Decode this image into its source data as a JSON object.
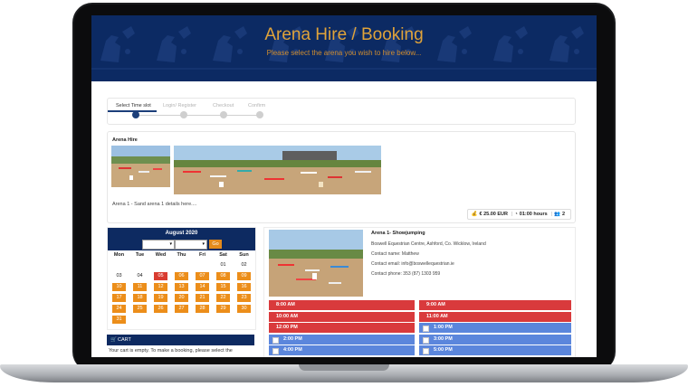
{
  "banner": {
    "title": "Arena Hire / Booking",
    "subtitle": "Please select the arena you wish to hire below..."
  },
  "steps": [
    "Select Time slot",
    "Login/ Register",
    "Checkout",
    "Confirm"
  ],
  "arena_card": {
    "title": "Arena Hire",
    "description": "Arena 1 - Sand arena 1 details here....",
    "price": "€ 25.00 EUR",
    "duration": "01:00 hours",
    "capacity": "2"
  },
  "calendar": {
    "month_label": "August   2020",
    "go_label": "Go",
    "weekdays": [
      "Mon",
      "Tue",
      "Wed",
      "Thu",
      "Fri",
      "Sat",
      "Sun"
    ],
    "days": [
      "01",
      "02",
      "03",
      "04",
      "05",
      "06",
      "07",
      "08",
      "09",
      "10",
      "11",
      "12",
      "13",
      "14",
      "15",
      "16",
      "17",
      "18",
      "19",
      "20",
      "21",
      "22",
      "23",
      "24",
      "25",
      "26",
      "27",
      "28",
      "29",
      "30",
      "31"
    ]
  },
  "cart": {
    "title": "CART",
    "message": "Your cart is empty. To make a booking, please select the"
  },
  "detail": {
    "name": "Arena 1- Showjumping",
    "address": "Boswell Equestrian Centre, Ashford, Co. Wicklow, Ireland",
    "contact_name": "Contact name: Matthew",
    "contact_email": "Contact email: info@boswellequestrian.ie",
    "contact_phone": "Contact phone: 353 (87) 1303 959"
  },
  "slots_left": [
    {
      "time": "8:00 AM",
      "status": "booked"
    },
    {
      "time": "10:00 AM",
      "status": "booked"
    },
    {
      "time": "12:00 PM",
      "status": "booked"
    },
    {
      "time": "2:00 PM",
      "status": "free"
    },
    {
      "time": "4:00 PM",
      "status": "free"
    },
    {
      "time": "6:00 PM",
      "status": "free"
    }
  ],
  "slots_right": [
    {
      "time": "9:00 AM",
      "status": "booked"
    },
    {
      "time": "11:00 AM",
      "status": "booked"
    },
    {
      "time": "1:00 PM",
      "status": "free"
    },
    {
      "time": "3:00 PM",
      "status": "free"
    },
    {
      "time": "5:00 PM",
      "status": "free"
    },
    {
      "time": "7:00 PM",
      "status": "free"
    }
  ],
  "colors": {
    "navy": "#0c2a63",
    "orange": "#ec8e1a",
    "booked_red": "#d93a3c",
    "free_blue": "#5b86dc",
    "banner_title": "#e0a33a"
  }
}
